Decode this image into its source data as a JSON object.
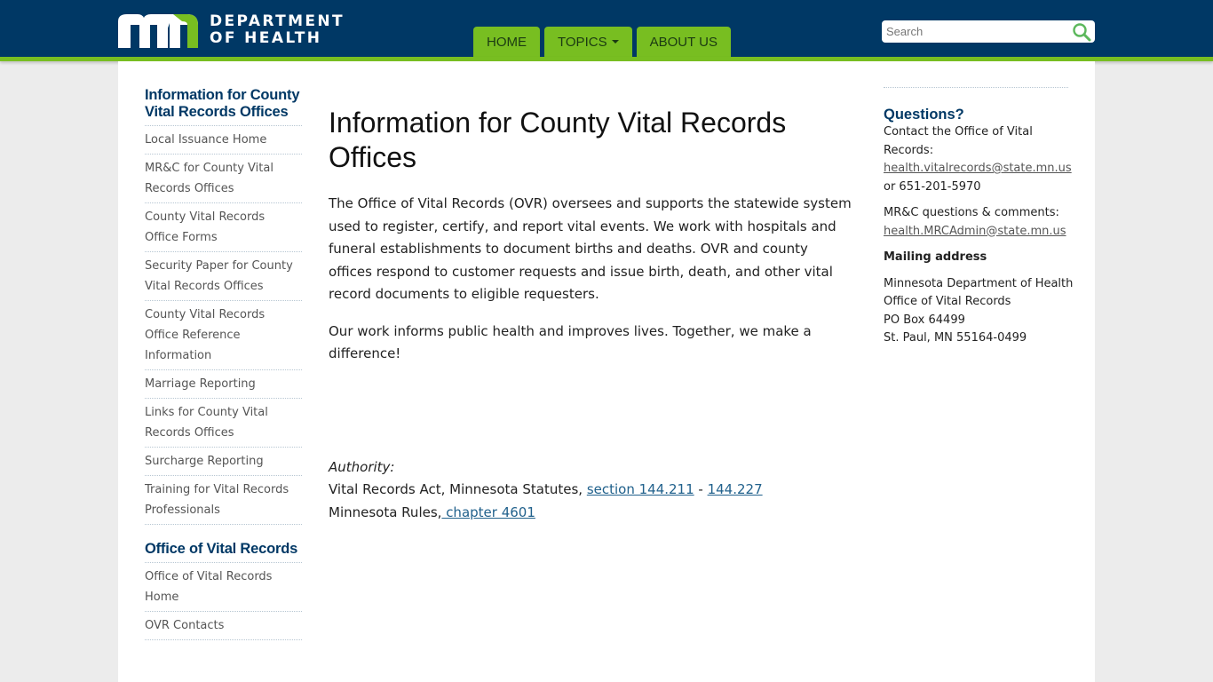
{
  "header": {
    "logo_line1": "DEPARTMENT",
    "logo_line2": "OF HEALTH",
    "logo_icon": "mn-logo-icon",
    "brand_colors": {
      "navy": "#003865",
      "green": "#78be21"
    }
  },
  "nav": {
    "tabs": [
      {
        "label": "HOME"
      },
      {
        "label": "TOPICS",
        "has_dropdown": true
      },
      {
        "label": "ABOUT US"
      }
    ]
  },
  "search": {
    "placeholder": "Search",
    "value": "",
    "icon": "search-icon"
  },
  "sidebar": {
    "section1_title": "Information for County Vital Records Offices",
    "section1_items": [
      {
        "label": "Local Issuance Home"
      },
      {
        "label": "MR&C for County Vital Records Offices"
      },
      {
        "label": "County Vital Records Office Forms"
      },
      {
        "label": "Security Paper for County Vital Records Offices"
      },
      {
        "label": "County Vital Records Office Reference Information"
      },
      {
        "label": "Marriage Reporting"
      },
      {
        "label": "Links for County Vital Records Offices"
      },
      {
        "label": "Surcharge Reporting"
      },
      {
        "label": "Training for Vital Records Professionals"
      }
    ],
    "section2_title": "Office of Vital Records",
    "section2_items": [
      {
        "label": "Office of Vital Records Home"
      },
      {
        "label": "OVR Contacts"
      }
    ]
  },
  "main": {
    "title": "Information for County Vital Records Offices",
    "paragraph1": "The Office of Vital Records (OVR) oversees and supports the statewide system used to register, certify, and report vital events. We work with hospitals and funeral establishments to document births and deaths. OVR and county offices respond to customer requests and issue birth, death, and other vital record documents to eligible requesters.",
    "paragraph2": "Our work informs public health and improves lives. Together, we make a difference!",
    "authority": {
      "label": "Authority:",
      "line1_prefix": "Vital Records Act, Minnesota Statutes, ",
      "link1": "section 144.211",
      "separator": " - ",
      "link2": "144.227",
      "line2_prefix": "Minnesota Rules,",
      "link3": " chapter 4601"
    }
  },
  "right": {
    "questions_title": "Questions?",
    "contact_text": "Contact the Office of Vital Records:",
    "contact_email": "health.vitalrecords@state.mn.us",
    "contact_phone": "or 651-201-5970",
    "mrc_text": "MR&C questions & comments:",
    "mrc_email": "health.MRCAdmin@state.mn.us",
    "mailing_title": "Mailing address",
    "address_lines": [
      "Minnesota Department of Health",
      "Office of Vital Records",
      "PO Box 64499",
      "St. Paul, MN 55164-0499"
    ]
  }
}
